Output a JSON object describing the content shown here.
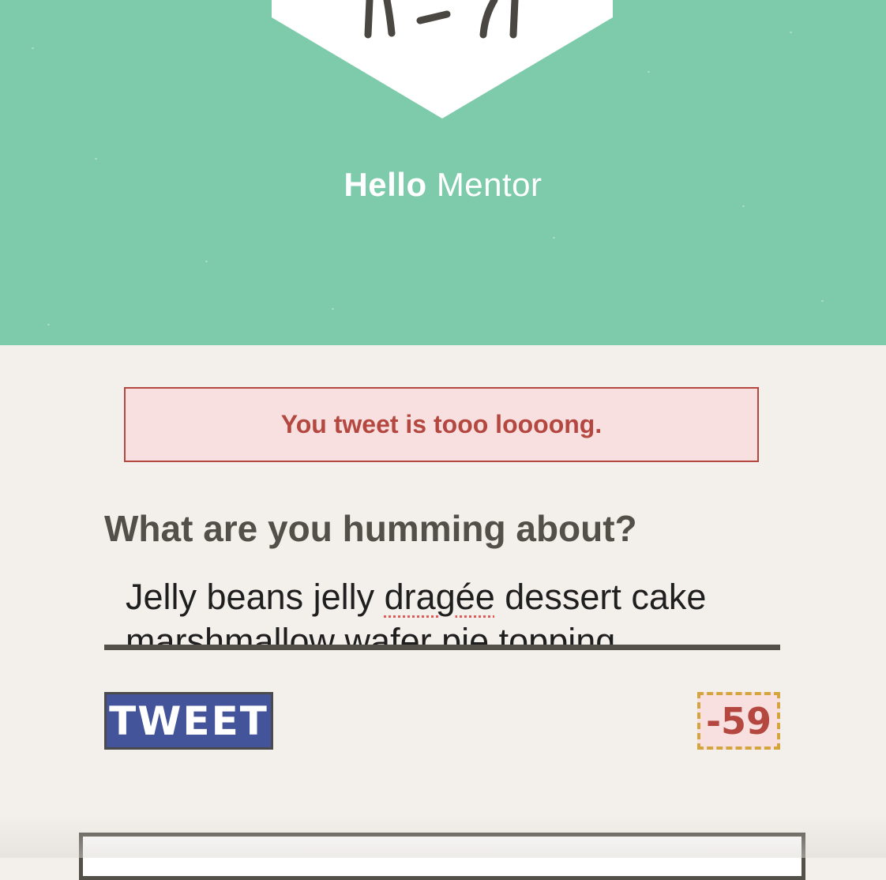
{
  "header": {
    "greeting_bold": "Hello",
    "greeting_name": "Mentor",
    "background_color": "#7ecbac"
  },
  "alert": {
    "message": "You tweet is tooo loooong."
  },
  "compose": {
    "label": "What are you humming about?",
    "text_part1": "Jelly beans jelly ",
    "text_misspelled": "dragée",
    "text_part2": " dessert cake marshmallow wafer pie topping"
  },
  "actions": {
    "tweet_label": "TWEET",
    "char_count": "-59"
  },
  "colors": {
    "error": "#b4473f",
    "button": "#44549a",
    "counter_border": "#d3a53c"
  },
  "icons": {
    "avatar": "robot-avatar-icon"
  }
}
